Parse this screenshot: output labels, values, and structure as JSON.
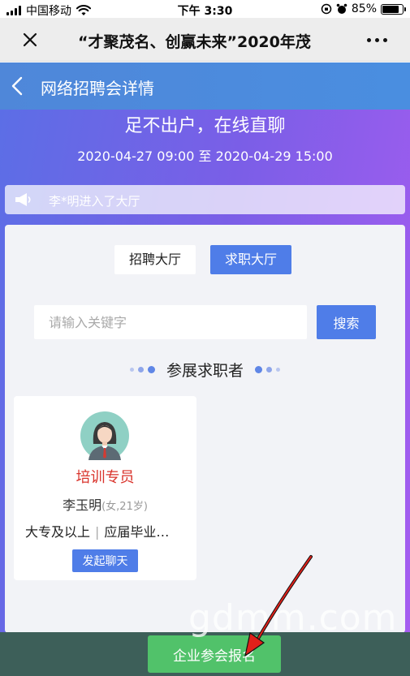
{
  "status_bar": {
    "carrier": "中国移动",
    "time": "下午 3:30",
    "battery": "85%",
    "battery_level": 0.85
  },
  "wechat_bar": {
    "title": "“才聚茂名、创赢未来”2020年茂"
  },
  "header": {
    "title": "网络招聘会详情"
  },
  "hero": {
    "slogan": "足不出户，在线直聊",
    "date_range": "2020-04-27 09:00 至 2020-04-29 15:00"
  },
  "notice": {
    "text": "李*明进入了大厅"
  },
  "tabs": {
    "recruit": "招聘大厅",
    "seeker": "求职大厅"
  },
  "search": {
    "placeholder": "请输入关键字",
    "button": "搜索"
  },
  "section": {
    "title": "参展求职者"
  },
  "candidate": {
    "position": "培训专员",
    "name": "李玉明",
    "meta": "(女,21岁)",
    "education": "大专及以上",
    "status": "应届毕业…",
    "chat_button": "发起聊天"
  },
  "footer": {
    "register_button": "企业参会报名"
  },
  "watermark": "gdmm.com",
  "colors": {
    "header_blue": "#4f87d9",
    "primary_button": "#4f7de8",
    "register_green": "#51c26a",
    "title_red": "#d9332b",
    "arrow_red": "#e0201a"
  }
}
